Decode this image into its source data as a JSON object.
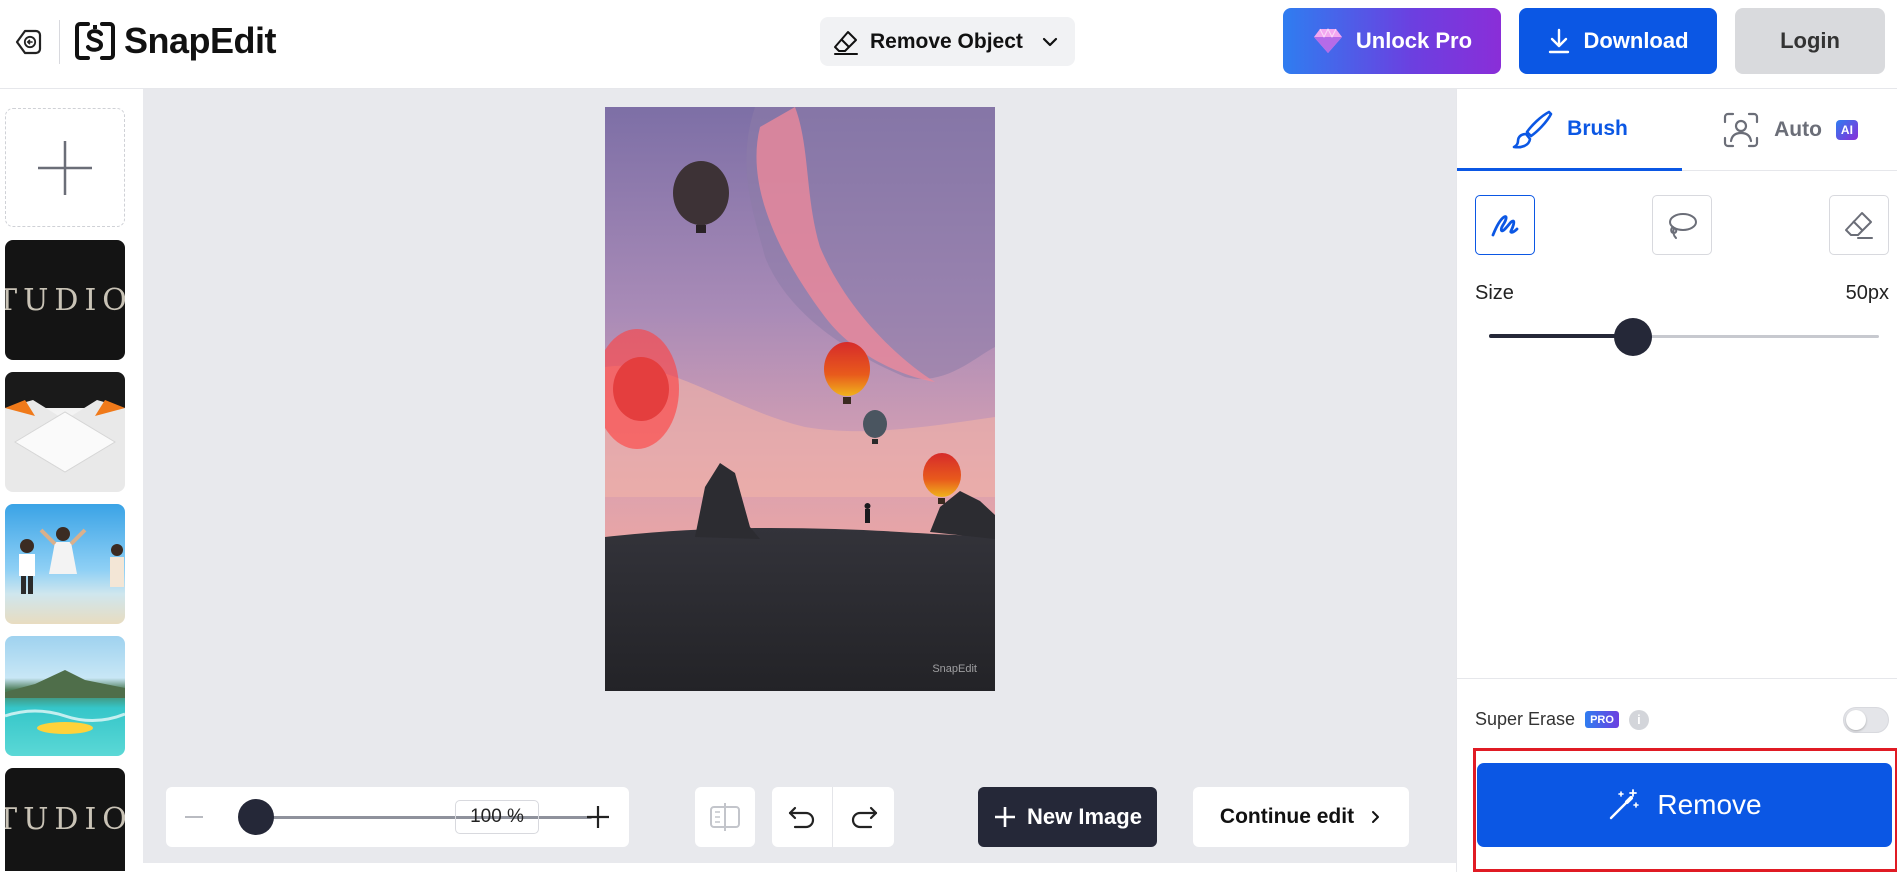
{
  "app": {
    "name": "SnapEdit"
  },
  "header": {
    "mode": "Remove Object",
    "unlock_label": "Unlock Pro",
    "download_label": "Download",
    "login_label": "Login"
  },
  "sidebar": {
    "thumbs": [
      {
        "type": "studio",
        "text": "TUDIO"
      },
      {
        "type": "geometric"
      },
      {
        "type": "beach"
      },
      {
        "type": "sea"
      },
      {
        "type": "studio",
        "text": "TUDIO"
      }
    ]
  },
  "canvas": {
    "watermark": "SnapEdit",
    "zoom_value": "100 %",
    "new_image_label": "New Image",
    "continue_label": "Continue edit"
  },
  "panel": {
    "tabs": [
      {
        "label": "Brush",
        "active": true
      },
      {
        "label": "Auto",
        "badge": "AI",
        "active": false
      }
    ],
    "size_label": "Size",
    "size_value": "50px",
    "size_fraction": 0.37,
    "super_erase_label": "Super Erase",
    "pro_badge": "PRO",
    "remove_label": "Remove"
  },
  "colors": {
    "primary": "#0b57e4",
    "dark": "#252838",
    "highlight": "#e01b24"
  }
}
